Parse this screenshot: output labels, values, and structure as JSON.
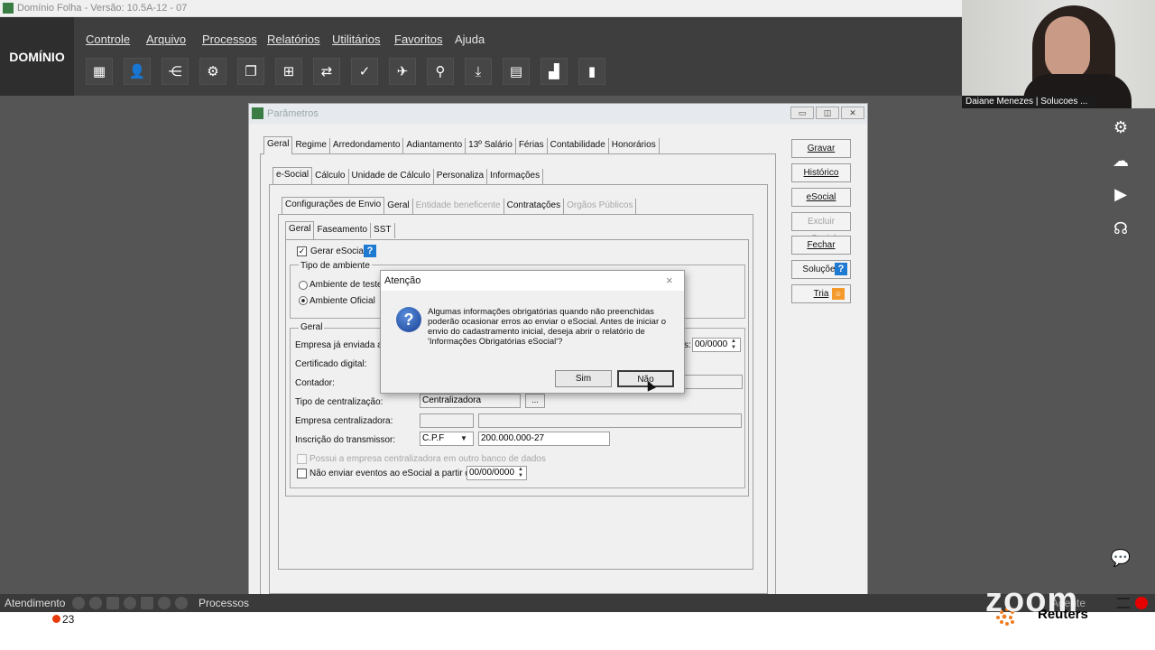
{
  "app": {
    "title": "Domínio Folha - Versão: 10.5A-12 - 07",
    "logo": "DOMÍNIO",
    "menus": [
      "Controle",
      "Arquivo",
      "Processos",
      "Relatórios",
      "Utilitários",
      "Favoritos",
      "Ajuda"
    ],
    "toolbar_icons": [
      "building-icon",
      "person-icon",
      "list-add-icon",
      "user-settings-icon",
      "document-copy-icon",
      "calculator-grid-icon",
      "transfer-icon",
      "document-check-icon",
      "airplane-icon",
      "search-icon",
      "download-icon",
      "calculator-icon",
      "chart-search-icon",
      "book-icon"
    ]
  },
  "window": {
    "title": "Parâmetros",
    "tabs_level1": [
      "Geral",
      "Regime",
      "Arredondamento",
      "Adiantamento",
      "13º Salário",
      "Férias",
      "Contabilidade",
      "Honorários"
    ],
    "tabs_level2": [
      "e-Social",
      "Cálculo",
      "Unidade de Cálculo",
      "Personaliza",
      "Informações"
    ],
    "tabs_level3": [
      "Configurações de Envio",
      "Geral",
      "Entidade beneficente",
      "Contratações",
      "Orgãos Públicos"
    ],
    "tabs_level4": [
      "Geral",
      "Faseamento",
      "SST"
    ],
    "side_buttons": [
      "Gravar",
      "Histórico",
      "eSocial",
      "Excluir eSocial",
      "Fechar",
      "Soluções",
      "Tria"
    ],
    "form": {
      "gerar_esocial": "Gerar eSocial",
      "tipo_ambiente_legend": "Tipo de ambiente",
      "ambiente_teste": "Ambiente de teste",
      "ambiente_oficial": "Ambiente Oficial",
      "geral_legend": "Geral",
      "empresa_enviada": "Empresa já enviada ant",
      "date_field": "00/0000",
      "date_label_tail": "s:",
      "certificado": "Certificado digital:",
      "contador": "Contador:",
      "tipo_centralizacao_label": "Tipo de centralização:",
      "tipo_centralizacao_value": "Centralizadora",
      "ellipsis": "...",
      "empresa_centralizadora": "Empresa centralizadora:",
      "inscricao_label": "Inscrição do transmissor:",
      "inscricao_tipo": "C.P.F",
      "inscricao_value": "200.000.000-27",
      "possui_outro_banco": "Possui a empresa centralizadora em outro banco de dados",
      "nao_enviar_label": "Não enviar eventos ao eSocial a partir de:",
      "nao_enviar_date": "00/00/0000"
    }
  },
  "dialog": {
    "title": "Atenção",
    "close": "×",
    "message": "Algumas informações obrigatórias quando não preenchidas poderão ocasionar erros ao enviar o eSocial. Antes de iniciar o envio do cadastramento inicial, deseja abrir o relatório de 'Informações Obrigatórias eSocial'?",
    "yes": "Sim",
    "no": "Não"
  },
  "zoom": {
    "participant": "Daiane Menezes | Solucoes ...",
    "logo": "zoom",
    "right_icons": [
      "gear-icon",
      "cloud-upload-icon",
      "play-icon",
      "headset-icon",
      "chat-icon"
    ]
  },
  "bottom": {
    "atendimento": "Atendimento",
    "processos": "Processos",
    "agente": "Agente",
    "counter": "23",
    "reuters": "Reuters"
  },
  "colors": {
    "accent_green": "#3a7d44",
    "dark_bar": "#3e3e3e",
    "help_blue": "#1f7ad1",
    "record_red": "#e60000"
  }
}
